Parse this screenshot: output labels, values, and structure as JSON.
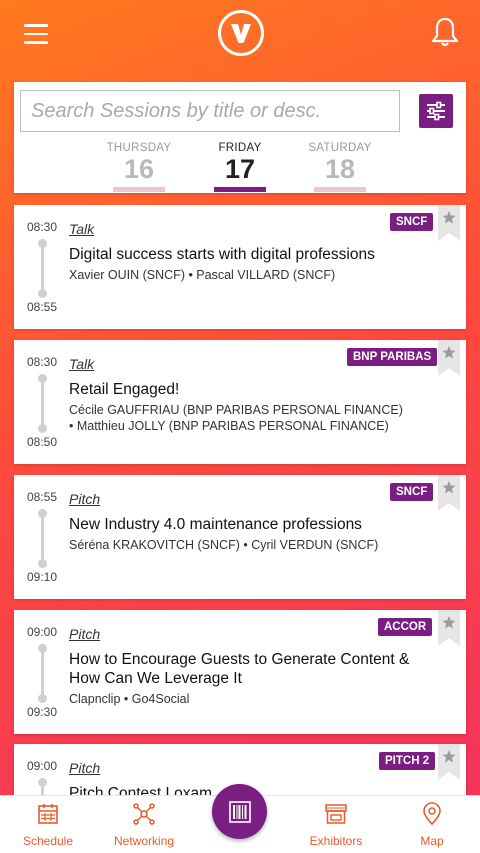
{
  "header": {
    "menu_icon": "hamburger-icon",
    "logo_letter": "V",
    "notification_icon": "bell-icon"
  },
  "search": {
    "placeholder": "Search Sessions by title or desc.",
    "value": "",
    "filter_icon": "sliders-icon"
  },
  "days": [
    {
      "name": "THURSDAY",
      "num": "16",
      "active": false
    },
    {
      "name": "FRIDAY",
      "num": "17",
      "active": true
    },
    {
      "name": "SATURDAY",
      "num": "18",
      "active": false
    }
  ],
  "sessions": [
    {
      "start": "08:30",
      "end": "08:55",
      "type": "Talk",
      "badge": "SNCF",
      "title": "Digital success starts with digital professions",
      "speakers": "Xavier OUIN (SNCF) • Pascal VILLARD (SNCF)"
    },
    {
      "start": "08:30",
      "end": "08:50",
      "type": "Talk",
      "badge": "BNP PARIBAS",
      "title": "Retail Engaged!",
      "speakers": "Cécile GAUFFRIAU (BNP PARIBAS PERSONAL FINANCE) • Matthieu JOLLY (BNP PARIBAS PERSONAL FINANCE)"
    },
    {
      "start": "08:55",
      "end": "09:10",
      "type": "Pitch",
      "badge": "SNCF",
      "title": "New Industry 4.0 maintenance professions",
      "speakers": "Séréna KRAKOVITCH (SNCF) • Cyril VERDUN (SNCF)"
    },
    {
      "start": "09:00",
      "end": "09:30",
      "type": "Pitch",
      "badge": "ACCOR",
      "title": "How to Encourage Guests to Generate Content & How Can We Leverage It",
      "speakers": "Clapnclip • Go4Social"
    },
    {
      "start": "09:00",
      "end": "",
      "type": "Pitch",
      "badge": "PITCH 2",
      "title": "Pitch Contest Loxam",
      "speakers": ""
    }
  ],
  "bottom_nav": [
    {
      "label": "Schedule",
      "icon": "calendar-icon"
    },
    {
      "label": "Networking",
      "icon": "network-icon"
    },
    {
      "label": "Exhibitors",
      "icon": "store-icon"
    },
    {
      "label": "Map",
      "icon": "map-pin-icon"
    }
  ],
  "fab_icon": "barcode-icon",
  "colors": {
    "accent": "#7b1e82",
    "brand_orange": "#ff6a1f",
    "nav_label": "#e85a2a"
  }
}
